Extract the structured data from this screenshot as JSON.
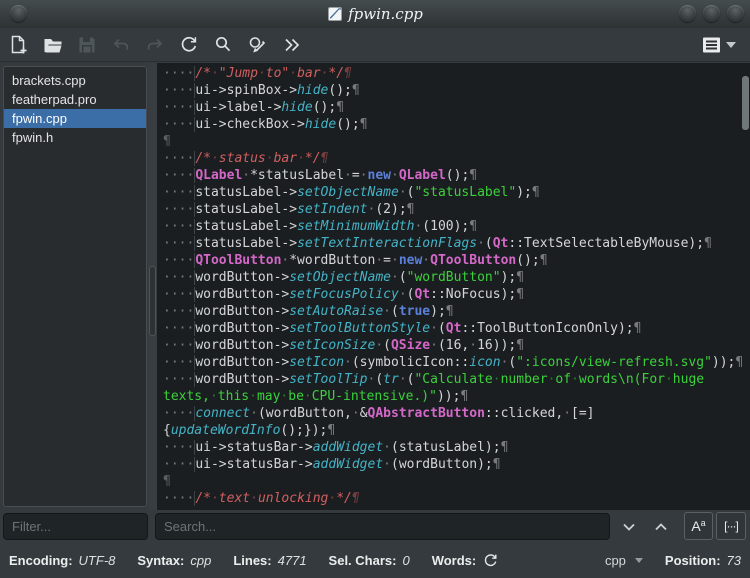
{
  "titlebar": {
    "title": "fpwin.cpp",
    "window_buttons": [
      "menu",
      "minimize",
      "maximize",
      "close"
    ]
  },
  "toolbar": {
    "buttons": [
      {
        "name": "new-document",
        "icon": "new-document",
        "enabled": true
      },
      {
        "name": "open-file",
        "icon": "open-folder",
        "enabled": true
      },
      {
        "name": "save",
        "icon": "save-floppy",
        "enabled": false
      },
      {
        "name": "undo",
        "icon": "undo-arrow",
        "enabled": false
      },
      {
        "name": "redo",
        "icon": "redo-arrow",
        "enabled": false
      },
      {
        "name": "reload",
        "icon": "reload-circular-arrow",
        "enabled": true
      },
      {
        "name": "search",
        "icon": "magnifier",
        "enabled": true
      },
      {
        "name": "find-replace",
        "icon": "magnifier-pencil",
        "enabled": true
      },
      {
        "name": "jump-commands",
        "icon": "double-chevron-right",
        "enabled": true
      }
    ],
    "menu_icon": "hamburger-menu"
  },
  "sidebar": {
    "files": [
      "brackets.cpp",
      "featherpad.pro",
      "fpwin.cpp",
      "fpwin.h"
    ],
    "selected_file": "fpwin.cpp",
    "selected_index": 2,
    "filter_placeholder": "Filter..."
  },
  "search": {
    "placeholder": "Search...",
    "match_case_main": "A",
    "match_case_sup": "a",
    "whole_word_label": "[···]"
  },
  "statusbar": {
    "encoding_label": "Encoding:",
    "encoding_value": "UTF-8",
    "syntax_label": "Syntax:",
    "syntax_value": "cpp",
    "lines_label": "Lines:",
    "lines_value": "4771",
    "sel_chars_label": "Sel. Chars:",
    "sel_chars_value": "0",
    "words_label": "Words:",
    "syntax_combo": "cpp",
    "position_label": "Position:",
    "position_value": "73"
  },
  "colors": {
    "selection_accent": "#3b6da7",
    "editor_background": "#1b1e21",
    "comment": "#d25f5f",
    "type": "#d468c8",
    "keyword": "#5c81da",
    "function": "#44b3c6",
    "string": "#3bd13b"
  },
  "editor": {
    "lines": [
      {
        "s": [
          {
            "t": "    ",
            "c": "txt ind"
          },
          {
            "t": "/* \"Jump to\" bar */",
            "c": "cmt"
          }
        ],
        "eol": 1
      },
      {
        "s": [
          {
            "t": "    ",
            "c": "txt ind"
          },
          {
            "t": "ui->spinBox->",
            "c": "txt"
          },
          {
            "t": "hide",
            "c": "fn"
          },
          {
            "t": "();",
            "c": "txt"
          }
        ],
        "eol": 1
      },
      {
        "s": [
          {
            "t": "    ",
            "c": "txt ind"
          },
          {
            "t": "ui->label->",
            "c": "txt"
          },
          {
            "t": "hide",
            "c": "fn"
          },
          {
            "t": "();",
            "c": "txt"
          }
        ],
        "eol": 1
      },
      {
        "s": [
          {
            "t": "    ",
            "c": "txt ind"
          },
          {
            "t": "ui->checkBox->",
            "c": "txt"
          },
          {
            "t": "hide",
            "c": "fn"
          },
          {
            "t": "();",
            "c": "txt"
          }
        ],
        "eol": 1
      },
      {
        "s": [],
        "eol": 1,
        "ec": "pl"
      },
      {
        "s": [
          {
            "t": "    ",
            "c": "txt ind"
          },
          {
            "t": "/* status bar */",
            "c": "cmt"
          }
        ],
        "eol": 1
      },
      {
        "s": [
          {
            "t": "    ",
            "c": "txt ind"
          },
          {
            "t": "QLabel",
            "c": "typ"
          },
          {
            "t": " *statusLabel = ",
            "c": "txt"
          },
          {
            "t": "new",
            "c": "kw"
          },
          {
            "t": " ",
            "c": "txt"
          },
          {
            "t": "QLabel",
            "c": "typ"
          },
          {
            "t": "();",
            "c": "txt"
          }
        ],
        "eol": 1
      },
      {
        "s": [
          {
            "t": "    ",
            "c": "txt ind"
          },
          {
            "t": "statusLabel->",
            "c": "txt"
          },
          {
            "t": "setObjectName",
            "c": "fn"
          },
          {
            "t": " (",
            "c": "txt"
          },
          {
            "t": "\"statusLabel\"",
            "c": "str"
          },
          {
            "t": ");",
            "c": "txt"
          }
        ],
        "eol": 1
      },
      {
        "s": [
          {
            "t": "    ",
            "c": "txt ind"
          },
          {
            "t": "statusLabel->",
            "c": "txt"
          },
          {
            "t": "setIndent",
            "c": "fn"
          },
          {
            "t": " (2);",
            "c": "txt"
          }
        ],
        "eol": 1
      },
      {
        "s": [
          {
            "t": "    ",
            "c": "txt ind"
          },
          {
            "t": "statusLabel->",
            "c": "txt"
          },
          {
            "t": "setMinimumWidth",
            "c": "fn"
          },
          {
            "t": " (100);",
            "c": "txt"
          }
        ],
        "eol": 1
      },
      {
        "s": [
          {
            "t": "    ",
            "c": "txt ind"
          },
          {
            "t": "statusLabel->",
            "c": "txt"
          },
          {
            "t": "setTextInteractionFlags",
            "c": "fn"
          },
          {
            "t": " (",
            "c": "txt"
          },
          {
            "t": "Qt",
            "c": "typ"
          },
          {
            "t": "::TextSelectableByMouse);",
            "c": "txt"
          }
        ],
        "eol": 1
      },
      {
        "s": [
          {
            "t": "    ",
            "c": "txt ind"
          },
          {
            "t": "QToolButton",
            "c": "typ"
          },
          {
            "t": " *wordButton = ",
            "c": "txt"
          },
          {
            "t": "new",
            "c": "kw"
          },
          {
            "t": " ",
            "c": "txt"
          },
          {
            "t": "QToolButton",
            "c": "typ"
          },
          {
            "t": "();",
            "c": "txt"
          }
        ],
        "eol": 1
      },
      {
        "s": [
          {
            "t": "    ",
            "c": "txt ind"
          },
          {
            "t": "wordButton->",
            "c": "txt"
          },
          {
            "t": "setObjectName",
            "c": "fn"
          },
          {
            "t": " (",
            "c": "txt"
          },
          {
            "t": "\"wordButton\"",
            "c": "str"
          },
          {
            "t": ");",
            "c": "txt"
          }
        ],
        "eol": 1
      },
      {
        "s": [
          {
            "t": "    ",
            "c": "txt ind"
          },
          {
            "t": "wordButton->",
            "c": "txt"
          },
          {
            "t": "setFocusPolicy",
            "c": "fn"
          },
          {
            "t": " (",
            "c": "txt"
          },
          {
            "t": "Qt",
            "c": "typ"
          },
          {
            "t": "::NoFocus);",
            "c": "txt"
          }
        ],
        "eol": 1
      },
      {
        "s": [
          {
            "t": "    ",
            "c": "txt ind"
          },
          {
            "t": "wordButton->",
            "c": "txt"
          },
          {
            "t": "setAutoRaise",
            "c": "fn"
          },
          {
            "t": " (",
            "c": "txt"
          },
          {
            "t": "true",
            "c": "kw"
          },
          {
            "t": ");",
            "c": "txt"
          }
        ],
        "eol": 1
      },
      {
        "s": [
          {
            "t": "    ",
            "c": "txt ind"
          },
          {
            "t": "wordButton->",
            "c": "txt"
          },
          {
            "t": "setToolButtonStyle",
            "c": "fn"
          },
          {
            "t": " (",
            "c": "txt"
          },
          {
            "t": "Qt",
            "c": "typ"
          },
          {
            "t": "::ToolButtonIconOnly);",
            "c": "txt"
          }
        ],
        "eol": 1
      },
      {
        "s": [
          {
            "t": "    ",
            "c": "txt ind"
          },
          {
            "t": "wordButton->",
            "c": "txt"
          },
          {
            "t": "setIconSize",
            "c": "fn"
          },
          {
            "t": " (",
            "c": "txt"
          },
          {
            "t": "QSize",
            "c": "typ"
          },
          {
            "t": " (16, 16));",
            "c": "txt"
          }
        ],
        "eol": 1
      },
      {
        "s": [
          {
            "t": "    ",
            "c": "txt ind"
          },
          {
            "t": "wordButton->",
            "c": "txt"
          },
          {
            "t": "setIcon",
            "c": "fn"
          },
          {
            "t": " (symbolicIcon::",
            "c": "txt"
          },
          {
            "t": "icon",
            "c": "fn"
          },
          {
            "t": " (",
            "c": "txt"
          },
          {
            "t": "\":icons/view-refresh.svg\"",
            "c": "str"
          },
          {
            "t": "));",
            "c": "txt"
          }
        ],
        "eol": 1
      },
      {
        "s": [
          {
            "t": "    ",
            "c": "txt ind"
          },
          {
            "t": "wordButton->",
            "c": "txt"
          },
          {
            "t": "setToolTip",
            "c": "fn"
          },
          {
            "t": " (",
            "c": "txt"
          },
          {
            "t": "tr",
            "c": "fn"
          },
          {
            "t": " (",
            "c": "txt"
          },
          {
            "t": "\"Calculate number of words\\n(For huge",
            "c": "str"
          }
        ],
        "eol": 0
      },
      {
        "s": [
          {
            "t": "texts, this may be CPU-intensive.)\"",
            "c": "str"
          },
          {
            "t": "));",
            "c": "txt"
          }
        ],
        "eol": 1
      },
      {
        "s": [
          {
            "t": "    ",
            "c": "txt ind"
          },
          {
            "t": "connect",
            "c": "fn"
          },
          {
            "t": " (wordButton, &",
            "c": "txt"
          },
          {
            "t": "QAbstractButton",
            "c": "typ"
          },
          {
            "t": "::clicked, [=]",
            "c": "txt"
          }
        ],
        "eol": 0
      },
      {
        "s": [
          {
            "t": "{",
            "c": "txt"
          },
          {
            "t": "updateWordInfo",
            "c": "fn"
          },
          {
            "t": "();});",
            "c": "txt"
          }
        ],
        "eol": 1
      },
      {
        "s": [
          {
            "t": "    ",
            "c": "txt ind"
          },
          {
            "t": "ui->statusBar->",
            "c": "txt"
          },
          {
            "t": "addWidget",
            "c": "fn"
          },
          {
            "t": " (statusLabel);",
            "c": "txt"
          }
        ],
        "eol": 1
      },
      {
        "s": [
          {
            "t": "    ",
            "c": "txt ind"
          },
          {
            "t": "ui->statusBar->",
            "c": "txt"
          },
          {
            "t": "addWidget",
            "c": "fn"
          },
          {
            "t": " (wordButton);",
            "c": "txt"
          }
        ],
        "eol": 1
      },
      {
        "s": [],
        "eol": 1,
        "ec": "pl"
      },
      {
        "s": [
          {
            "t": "    ",
            "c": "txt ind"
          },
          {
            "t": "/* text unlocking */",
            "c": "cmt"
          }
        ],
        "eol": 1
      }
    ]
  }
}
